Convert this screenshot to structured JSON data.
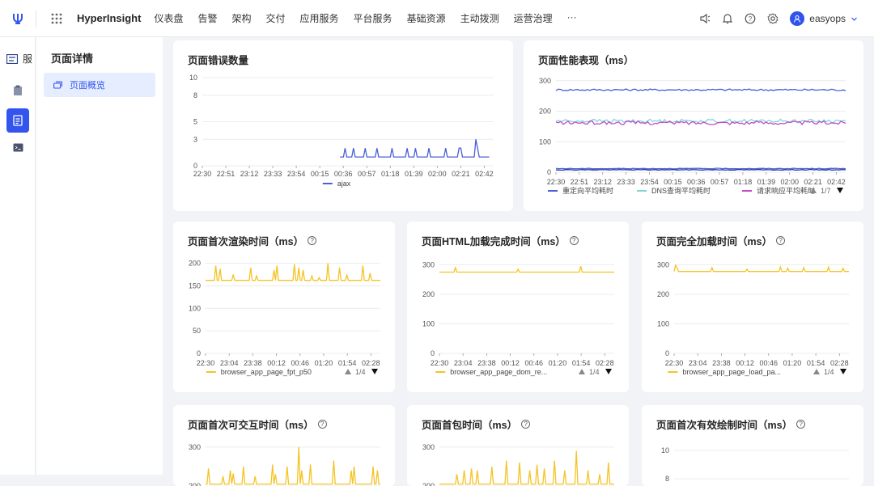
{
  "header": {
    "brand": "HyperInsight",
    "nav": [
      "仪表盘",
      "告警",
      "架构",
      "交付",
      "应用服务",
      "平台服务",
      "基础资源",
      "主动拨测",
      "运营治理",
      "···"
    ],
    "user": "easyops"
  },
  "rail": {
    "top_label": "服"
  },
  "subnav": {
    "title": "页面详情",
    "item": "页面概览"
  },
  "colors": {
    "accent": "#3355ee",
    "blue": "#4a5fd6",
    "yellow": "#f5c324",
    "magenta": "#c14bc9",
    "cyan": "#7fd8d3"
  },
  "cards": {
    "errors": {
      "title": "页面错误数量"
    },
    "perf": {
      "title": "页面性能表现（ms）",
      "pager": "1/7"
    },
    "fpt": {
      "title": "页面首次渲染时间（ms）",
      "pager": "1/4"
    },
    "dom": {
      "title": "页面HTML加载完成时间（ms）",
      "pager": "1/4"
    },
    "load": {
      "title": "页面完全加载时间（ms）",
      "pager": "1/4"
    },
    "tti": {
      "title": "页面首次可交互时间（ms）"
    },
    "fb": {
      "title": "页面首包时间（ms）"
    },
    "fmp": {
      "title": "页面首次有效绘制时间（ms）"
    }
  },
  "chart_data": [
    {
      "id": "errors",
      "type": "line",
      "x_ticks": [
        "22:30",
        "22:51",
        "23:12",
        "23:33",
        "23:54",
        "00:15",
        "00:36",
        "00:57",
        "01:18",
        "01:39",
        "02:00",
        "02:21",
        "02:42"
      ],
      "y_ticks": [
        "0",
        "3",
        "5",
        "8",
        "10"
      ],
      "ylim": [
        0,
        10
      ],
      "series": [
        {
          "name": "ajax",
          "color": "#4a5fd6",
          "start": 0.48,
          "end": 1.0,
          "values": [
            1,
            1,
            1,
            2,
            1,
            1,
            1,
            1,
            2,
            1,
            1,
            1,
            1,
            1,
            1,
            2,
            1,
            1,
            1,
            1,
            1,
            1,
            2,
            1,
            1,
            1,
            1,
            1,
            1,
            1,
            1,
            2,
            1,
            1,
            1,
            1,
            1,
            1,
            1,
            1,
            2,
            1,
            1,
            1,
            1,
            2,
            1,
            1,
            1,
            1,
            1,
            1,
            1,
            2,
            1,
            1,
            1,
            1,
            1,
            1,
            1,
            1,
            1,
            2,
            1,
            1,
            1,
            1,
            1,
            1,
            1,
            2,
            2,
            1,
            1,
            1,
            1,
            1,
            1,
            1,
            1,
            3,
            2,
            1,
            1,
            1,
            1,
            1,
            1,
            1
          ]
        }
      ],
      "legend": [
        "ajax"
      ]
    },
    {
      "id": "perf",
      "type": "line",
      "x_ticks": [
        "22:30",
        "22:51",
        "23:12",
        "23:33",
        "23:54",
        "00:15",
        "00:36",
        "00:57",
        "01:18",
        "01:39",
        "02:00",
        "02:21",
        "02:42"
      ],
      "y_ticks": [
        "0",
        "100",
        "200",
        "300"
      ],
      "ylim": [
        0,
        310
      ],
      "series": [
        {
          "name": "重定向平均耗时",
          "color": "#4a5fd6",
          "level": 270,
          "noise": 3
        },
        {
          "name": "DNS查询平均耗时",
          "color": "#7fd8d3",
          "level": 168,
          "noise": 6
        },
        {
          "name": "请求响应平均耗时",
          "color": "#c14bc9",
          "level": 162,
          "noise": 6
        },
        {
          "name": "",
          "color": "#4a5fd6",
          "level": 12,
          "noise": 1
        },
        {
          "name": "",
          "color": "#2b3ca8",
          "level": 8,
          "noise": 1
        }
      ],
      "legend": [
        "重定向平均耗时",
        "DNS查询平均耗时",
        "请求响应平均耗时"
      ]
    },
    {
      "id": "fpt",
      "type": "line",
      "x_ticks": [
        "22:30",
        "23:04",
        "23:38",
        "00:12",
        "00:46",
        "01:20",
        "01:54",
        "02:28"
      ],
      "y_ticks": [
        "0",
        "50",
        "100",
        "150",
        "200"
      ],
      "ylim": [
        0,
        210
      ],
      "series": [
        {
          "name": "browser_app_page_fpt_p50",
          "color": "#f5c324",
          "level": 162,
          "spikes": [
            [
              0.06,
              195
            ],
            [
              0.08,
              188
            ],
            [
              0.16,
              175
            ],
            [
              0.26,
              190
            ],
            [
              0.29,
              172
            ],
            [
              0.39,
              185
            ],
            [
              0.41,
              195
            ],
            [
              0.51,
              198
            ],
            [
              0.53,
              190
            ],
            [
              0.56,
              185
            ],
            [
              0.61,
              172
            ],
            [
              0.65,
              168
            ],
            [
              0.7,
              200
            ],
            [
              0.77,
              190
            ],
            [
              0.81,
              175
            ],
            [
              0.9,
              195
            ],
            [
              0.94,
              178
            ]
          ]
        }
      ],
      "legend": [
        "browser_app_page_fpt_p50"
      ]
    },
    {
      "id": "dom",
      "type": "line",
      "x_ticks": [
        "22:30",
        "23:04",
        "23:38",
        "00:12",
        "00:46",
        "01:20",
        "01:54",
        "02:28"
      ],
      "y_ticks": [
        "0",
        "100",
        "200",
        "300"
      ],
      "ylim": [
        0,
        320
      ],
      "series": [
        {
          "name": "browser_app_page_dom_re...",
          "color": "#f5c324",
          "level": 275,
          "spikes": [
            [
              0.09,
              290
            ],
            [
              0.45,
              285
            ],
            [
              0.81,
              295
            ]
          ]
        }
      ],
      "legend": [
        "browser_app_page_dom_re..."
      ]
    },
    {
      "id": "load",
      "type": "line",
      "x_ticks": [
        "22:30",
        "23:04",
        "23:38",
        "00:12",
        "00:46",
        "01:20",
        "01:54",
        "02:28"
      ],
      "y_ticks": [
        "0",
        "100",
        "200",
        "300"
      ],
      "ylim": [
        0,
        320
      ],
      "series": [
        {
          "name": "browser_app_page_load_pa...",
          "color": "#f5c324",
          "level": 277,
          "spikes": [
            [
              0.01,
              298
            ],
            [
              0.02,
              290
            ],
            [
              0.22,
              290
            ],
            [
              0.42,
              285
            ],
            [
              0.61,
              292
            ],
            [
              0.65,
              288
            ],
            [
              0.74,
              290
            ],
            [
              0.88,
              292
            ],
            [
              0.97,
              288
            ]
          ]
        }
      ],
      "legend": [
        "browser_app_page_load_pa..."
      ]
    },
    {
      "id": "tti",
      "type": "line",
      "y_ticks": [
        "200",
        "300"
      ],
      "ylim": [
        200,
        310
      ],
      "series": [
        {
          "name": "",
          "color": "#f5c324",
          "level": 205,
          "spikes": [
            [
              0.02,
              245
            ],
            [
              0.1,
              225
            ],
            [
              0.14,
              240
            ],
            [
              0.16,
              232
            ],
            [
              0.22,
              250
            ],
            [
              0.28,
              225
            ],
            [
              0.38,
              255
            ],
            [
              0.4,
              230
            ],
            [
              0.47,
              250
            ],
            [
              0.53,
              300
            ],
            [
              0.55,
              240
            ],
            [
              0.6,
              255
            ],
            [
              0.73,
              265
            ],
            [
              0.83,
              240
            ],
            [
              0.85,
              250
            ],
            [
              0.96,
              250
            ],
            [
              0.98,
              240
            ]
          ]
        }
      ]
    },
    {
      "id": "fb",
      "type": "line",
      "y_ticks": [
        "200",
        "300"
      ],
      "ylim": [
        200,
        310
      ],
      "series": [
        {
          "name": "",
          "color": "#f5c324",
          "level": 205,
          "spikes": [
            [
              0.1,
              230
            ],
            [
              0.14,
              240
            ],
            [
              0.18,
              245
            ],
            [
              0.22,
              240
            ],
            [
              0.3,
              250
            ],
            [
              0.38,
              265
            ],
            [
              0.46,
              260
            ],
            [
              0.52,
              240
            ],
            [
              0.56,
              255
            ],
            [
              0.6,
              245
            ],
            [
              0.66,
              265
            ],
            [
              0.72,
              240
            ],
            [
              0.78,
              290
            ],
            [
              0.85,
              240
            ],
            [
              0.92,
              230
            ],
            [
              0.97,
              260
            ]
          ]
        }
      ]
    },
    {
      "id": "fmp",
      "type": "line",
      "y_ticks": [
        "8",
        "10"
      ],
      "ylim": [
        7.5,
        10.5
      ],
      "series": []
    }
  ]
}
